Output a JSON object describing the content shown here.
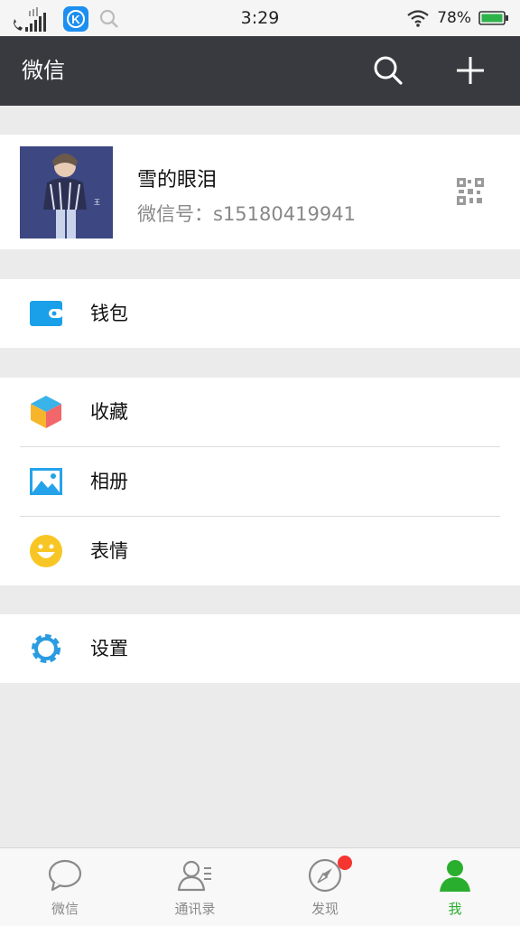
{
  "status_bar": {
    "time": "3:29",
    "battery": "78%",
    "icons": [
      "call-signal-icon",
      "kugou-app-icon",
      "search-icon",
      "wifi-icon",
      "battery-icon"
    ]
  },
  "header": {
    "title": "微信",
    "icons": [
      "search-icon",
      "add-icon"
    ]
  },
  "profile": {
    "name": "雪的眼泪",
    "wechat_id_label": "微信号：",
    "wechat_id": "s15180419941",
    "icons": [
      "avatar-photo",
      "qr-code-icon"
    ]
  },
  "menu": {
    "wallet": "钱包",
    "favorites": "收藏",
    "album": "相册",
    "stickers": "表情",
    "settings": "设置"
  },
  "tabs": [
    {
      "label": "微信",
      "icon": "chat-bubble-icon",
      "active": false
    },
    {
      "label": "通讯录",
      "icon": "contacts-icon",
      "active": false
    },
    {
      "label": "发现",
      "icon": "compass-icon",
      "active": false,
      "badge": true
    },
    {
      "label": "我",
      "icon": "person-icon",
      "active": true
    }
  ],
  "colors": {
    "header_bg": "#393a3f",
    "active_tab": "#2aae2e",
    "badge": "#f43530",
    "wallet_icon": "#1aa0e8"
  }
}
